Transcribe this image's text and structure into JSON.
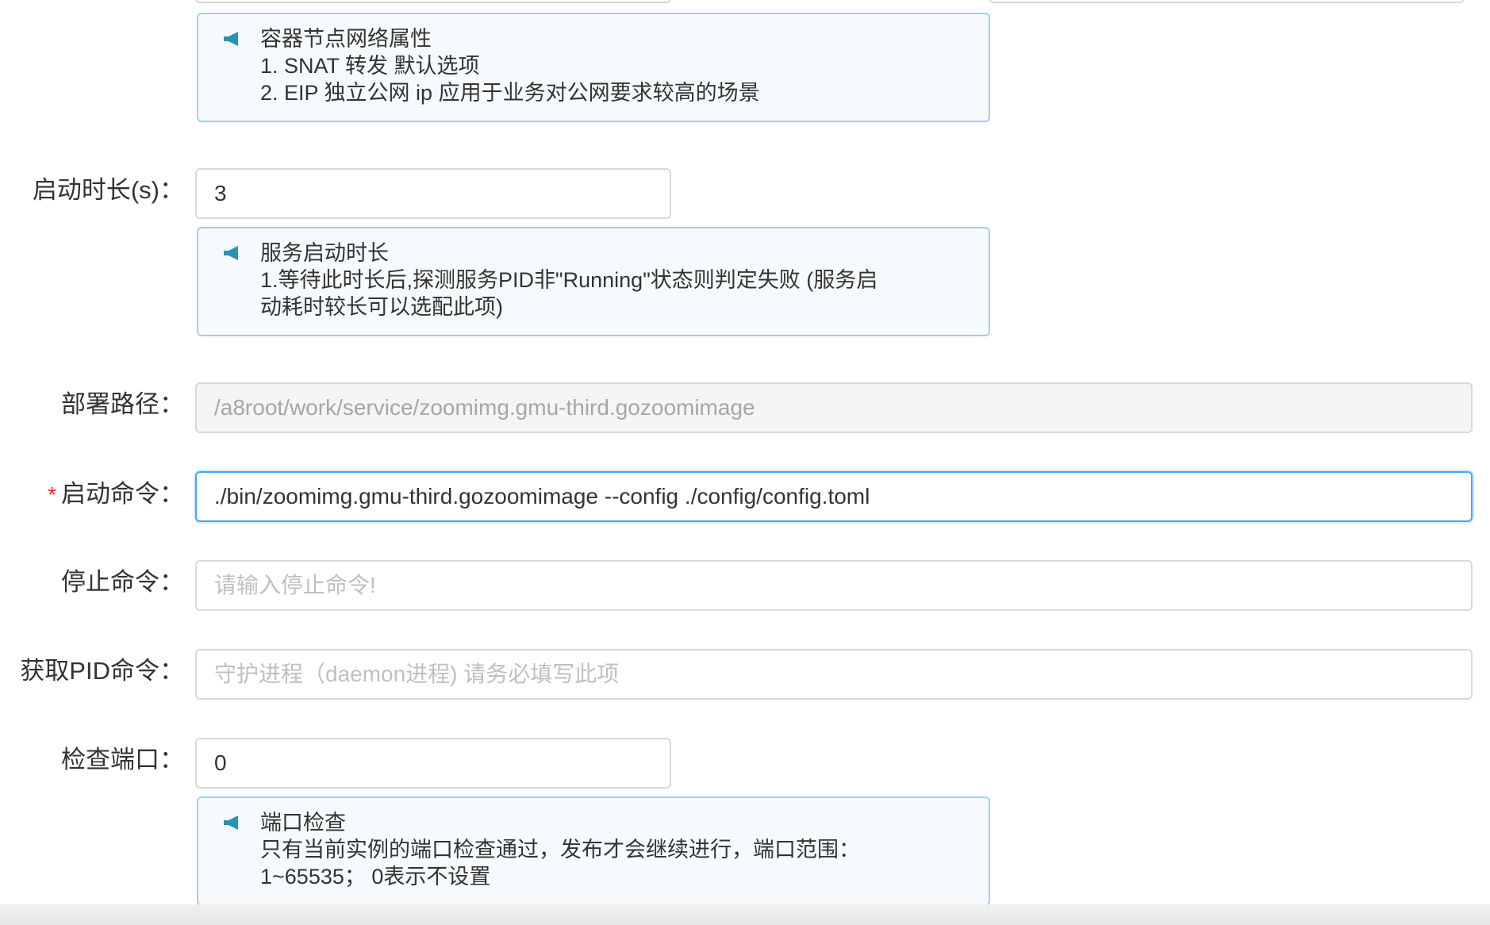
{
  "tips": {
    "network": {
      "icon": "megaphone-icon",
      "lines": [
        "容器节点网络属性",
        "1. SNAT 转发 默认选项",
        "2. EIP 独立公网 ip 应用于业务对公网要求较高的场景"
      ]
    },
    "startup": {
      "icon": "megaphone-icon",
      "lines": [
        "服务启动时长",
        "1.等待此时长后,探测服务PID非\"Running\"状态则判定失败 (服务启",
        "动耗时较长可以选配此项)"
      ]
    },
    "port": {
      "icon": "megaphone-icon",
      "lines": [
        "端口检查",
        "只有当前实例的端口检查通过，发布才会继续进行，端口范围：",
        "1~65535； 0表示不设置"
      ]
    }
  },
  "form": {
    "startup_duration": {
      "label": "启动时长(s)：",
      "value": "3"
    },
    "deploy_path": {
      "label": "部署路径：",
      "value": "/a8root/work/service/zoomimg.gmu-third.gozoomimage"
    },
    "start_command": {
      "required_mark": "*",
      "label": "启动命令：",
      "value": "./bin/zoomimg.gmu-third.gozoomimage --config ./config/config.toml"
    },
    "stop_command": {
      "label": "停止命令：",
      "value": "",
      "placeholder": "请输入停止命令!"
    },
    "pid_command": {
      "label": "获取PID命令：",
      "value": "",
      "placeholder": "守护进程（daemon进程) 请务必填写此项"
    },
    "check_port": {
      "label": "检查端口：",
      "value": "0"
    }
  },
  "colors": {
    "tip_border": "#9fd1ea",
    "tip_background": "#f6fafc",
    "icon": "#2a93b5",
    "required": "#f5222d",
    "focus_border": "#40a9ff"
  }
}
